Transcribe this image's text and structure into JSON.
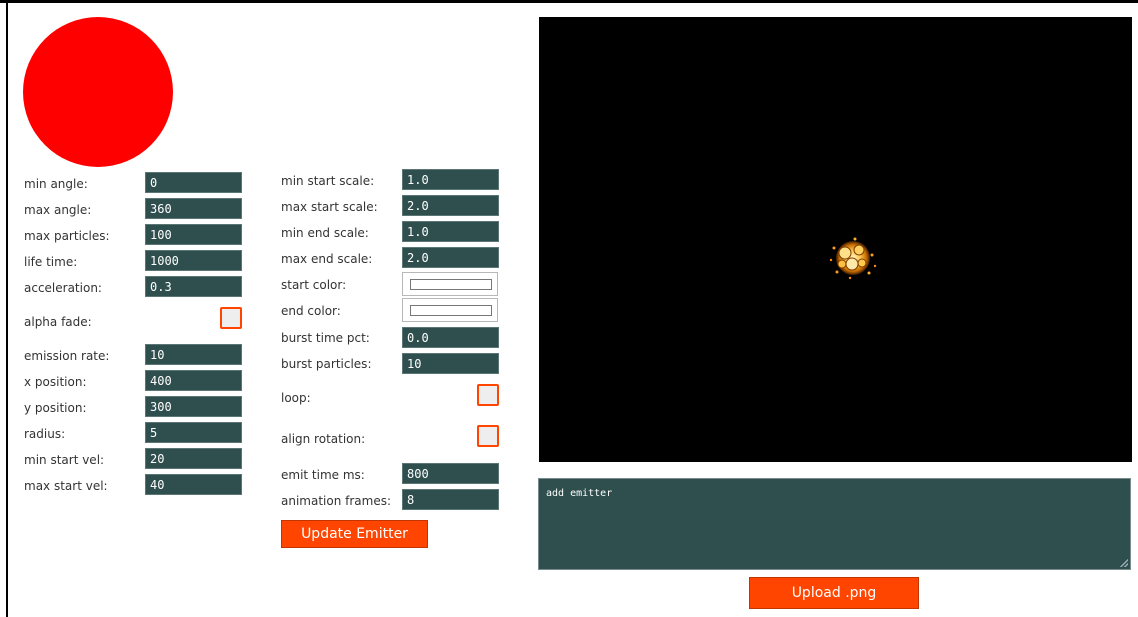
{
  "left_fields": [
    {
      "label": "min angle:",
      "value": "0"
    },
    {
      "label": "max angle:",
      "value": "360"
    },
    {
      "label": "max particles:",
      "value": "100"
    },
    {
      "label": "life time:",
      "value": "1000"
    },
    {
      "label": "acceleration:",
      "value": "0.3"
    }
  ],
  "alpha_fade": {
    "label": "alpha fade:",
    "checked": false
  },
  "left_fields_2": [
    {
      "label": "emission rate:",
      "value": "10"
    },
    {
      "label": "x position:",
      "value": "400"
    },
    {
      "label": "y position:",
      "value": "300"
    },
    {
      "label": "radius:",
      "value": "5"
    },
    {
      "label": "min start vel:",
      "value": "20"
    },
    {
      "label": "max start vel:",
      "value": "40"
    }
  ],
  "mid_fields": [
    {
      "label": "min start scale:",
      "value": "1.0"
    },
    {
      "label": "max start scale:",
      "value": "2.0"
    },
    {
      "label": "min end scale:",
      "value": "1.0"
    },
    {
      "label": "max end scale:",
      "value": "2.0"
    }
  ],
  "start_color": {
    "label": "start color:",
    "value": "#ffffff"
  },
  "end_color": {
    "label": "end color:",
    "value": "#ffffff"
  },
  "mid_fields_2": [
    {
      "label": "burst time pct:",
      "value": "0.0"
    },
    {
      "label": "burst particles:",
      "value": "10"
    }
  ],
  "loop": {
    "label": "loop:",
    "checked": false
  },
  "align_rotation": {
    "label": "align rotation:",
    "checked": false
  },
  "mid_fields_3": [
    {
      "label": "emit time ms:",
      "value": "800"
    },
    {
      "label": "animation frames:",
      "value": "8"
    }
  ],
  "update_button": "Update Emitter",
  "console_text": "add emitter",
  "upload_button": "Upload .png",
  "colors": {
    "accent": "#ff4500",
    "input_bg": "#2f4f4f",
    "logo": "#ff0000",
    "canvas_bg": "#000000"
  }
}
